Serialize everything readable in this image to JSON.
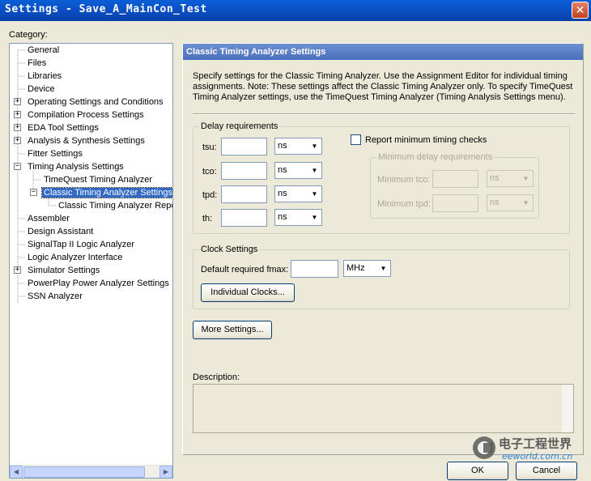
{
  "window": {
    "title": "Settings - Save_A_MainCon_Test",
    "close_glyph": "✕"
  },
  "category": {
    "label": "Category:",
    "items": [
      {
        "label": "General"
      },
      {
        "label": "Files"
      },
      {
        "label": "Libraries"
      },
      {
        "label": "Device"
      },
      {
        "label": "Operating Settings and Conditions",
        "expander": "+"
      },
      {
        "label": "Compilation Process Settings",
        "expander": "+"
      },
      {
        "label": "EDA Tool Settings",
        "expander": "+"
      },
      {
        "label": "Analysis & Synthesis Settings",
        "expander": "+"
      },
      {
        "label": "Fitter Settings"
      },
      {
        "label": "Timing Analysis Settings",
        "expander": "−"
      },
      {
        "label": "TimeQuest Timing Analyzer"
      },
      {
        "label": "Classic Timing Analyzer Settings",
        "expander": "−",
        "selected": true
      },
      {
        "label": "Classic Timing Analyzer Repor"
      },
      {
        "label": "Assembler"
      },
      {
        "label": "Design Assistant"
      },
      {
        "label": "SignalTap II Logic Analyzer"
      },
      {
        "label": "Logic Analyzer Interface"
      },
      {
        "label": "Simulator Settings",
        "expander": "+"
      },
      {
        "label": "PowerPlay Power Analyzer Settings"
      },
      {
        "label": "SSN Analyzer"
      }
    ],
    "scroll_left": "◀",
    "scroll_right": "▶"
  },
  "panel": {
    "header": "Classic Timing Analyzer Settings",
    "description_lines": [
      "Specify settings for the Classic Timing Analyzer. Use the Assignment Editor for individual timing",
      "assignments. Note: These settings affect the Classic Timing Analyzer only. To specify TimeQuest",
      "Timing Analyzer settings, use the TimeQuest Timing Analyzer (Timing Analysis Settings menu)."
    ],
    "delay": {
      "title": "Delay requirements",
      "rows": [
        {
          "label": "tsu:",
          "unit": "ns"
        },
        {
          "label": "tco:",
          "unit": "ns"
        },
        {
          "label": "tpd:",
          "unit": "ns"
        },
        {
          "label": "th:",
          "unit": "ns"
        }
      ],
      "report_min_label": "Report minimum timing checks",
      "min_group_title": "Minimum delay requirements",
      "min_rows": [
        {
          "label": "Minimum tco:",
          "unit": "ns"
        },
        {
          "label": "Minimum tpd:",
          "unit": "ns"
        }
      ]
    },
    "clock": {
      "title": "Clock Settings",
      "fmax_label": "Default required fmax:",
      "fmax_unit": "MHz",
      "individual_clocks_button": "Individual Clocks..."
    },
    "more_settings_button": "More Settings...",
    "description_label": "Description:"
  },
  "footer": {
    "ok_button": "OK",
    "cancel_button": "Cancel"
  },
  "watermark": {
    "text_cn": "电子工程世界",
    "text_url": "eeworld.com.cn"
  },
  "dropdown_glyph": "▼"
}
